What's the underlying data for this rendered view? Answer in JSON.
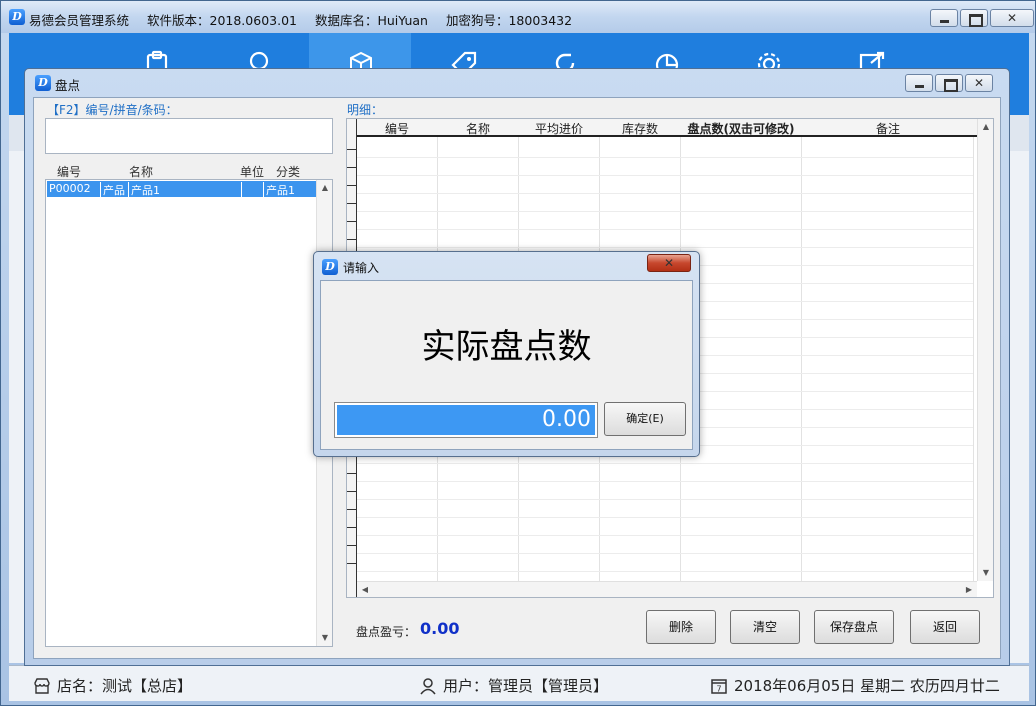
{
  "app": {
    "title": "易德会员管理系统",
    "version": "软件版本：2018.0603.01",
    "database": "数据库名：HuiYuan",
    "dongle": "加密狗号：18003432",
    "icon_letter": "D"
  },
  "nav": {
    "icons": [
      "clipboard-icon",
      "users-icon",
      "box-icon",
      "tag-icon",
      "refresh-icon",
      "pie-chart-icon",
      "gear-icon",
      "exit-icon"
    ]
  },
  "status": {
    "shop": "店名：测试【总店】",
    "user": "用户：管理员【管理员】",
    "date": "2018年06月05日 星期二 农历四月廿二",
    "cal_day": "7"
  },
  "stocktake": {
    "title": "盘点",
    "search_label": "【F2】编号/拼音/条码：",
    "search_value": "",
    "list_columns": [
      "编号",
      "名称",
      "单位",
      "分类"
    ],
    "list_rows": [
      {
        "code": "P00002",
        "name1": "产品",
        "name2": "产品1",
        "unit": "",
        "category": "产品1"
      }
    ],
    "detail_label": "明细：",
    "grid_columns": [
      "编号",
      "名称",
      "平均进价",
      "库存数",
      "盘点数(双击可修改)",
      "备注"
    ],
    "profit_label": "盘点盈亏：",
    "profit_value": "0.00",
    "buttons": {
      "delete": "删除",
      "clear": "清空",
      "save": "保存盘点",
      "back": "返回"
    }
  },
  "dialog": {
    "title": "请输入",
    "heading": "实际盘点数",
    "value": "0.00",
    "ok_label": "确定(E)"
  },
  "colors": {
    "nav_blue": "#1f7ede",
    "selection_blue": "#3b94ee",
    "profit_value": "#1030c8",
    "label_blue": "#1f6fc6"
  }
}
